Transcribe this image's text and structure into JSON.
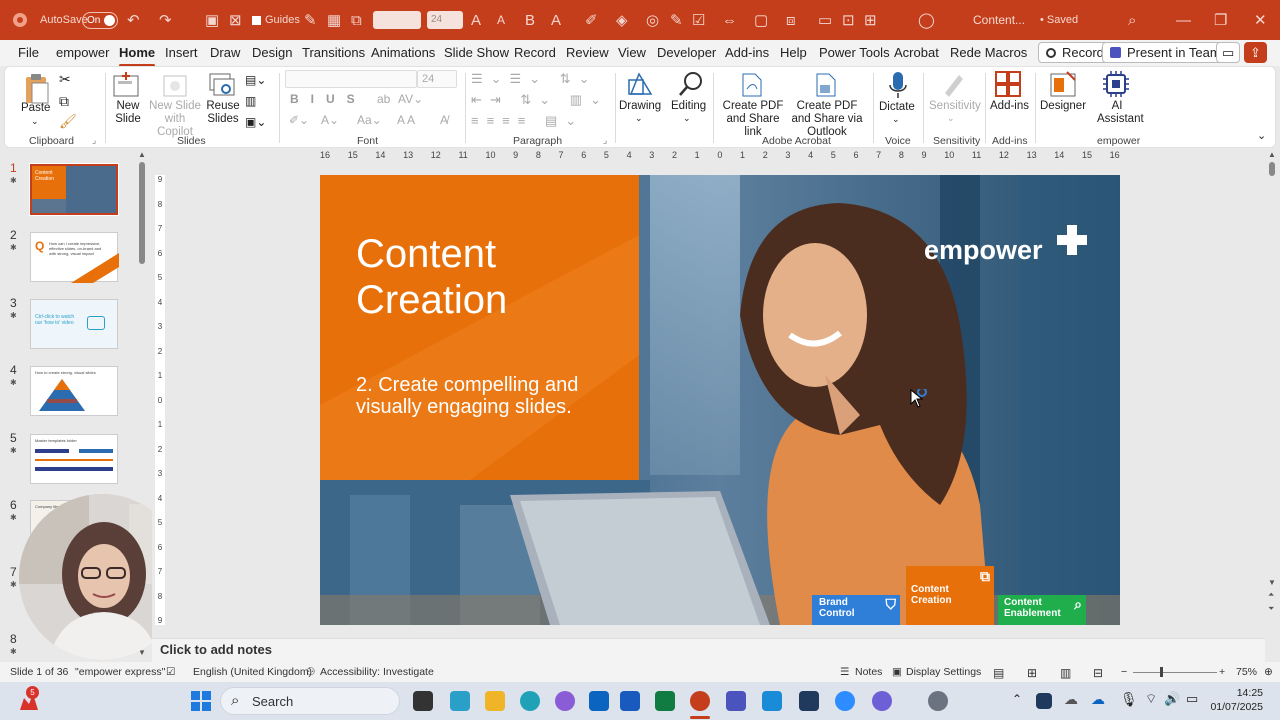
{
  "titlebar": {
    "autosave_label": "AutoSave",
    "autosave_state": "On",
    "guides_label": "Guides",
    "font_size": "24",
    "doc_title": "Content...",
    "saved_status": "• Saved"
  },
  "menu": {
    "items": [
      "File",
      "empower",
      "Home",
      "Insert",
      "Draw",
      "Design",
      "Transitions",
      "Animations",
      "Slide Show",
      "Record",
      "Review",
      "View",
      "Developer",
      "Add-ins",
      "Help",
      "Power Tools",
      "Acrobat",
      "Rede Macros"
    ],
    "record_button": "Record",
    "present_teams_button": "Present in Teams"
  },
  "ribbon": {
    "paste": "Paste",
    "clipboard_group": "Clipboard",
    "new_slide": "New Slide",
    "new_slide_copilot": "New Slide with Copilot",
    "reuse_slides": "Reuse Slides",
    "slides_group": "Slides",
    "font_size_box": "24",
    "font_group": "Font",
    "paragraph_group": "Paragraph",
    "drawing": "Drawing",
    "editing": "Editing",
    "create_pdf_share": "Create PDF and Share link",
    "create_pdf_outlook": "Create PDF and Share via Outlook",
    "acrobat_group": "Adobe Acrobat",
    "dictate": "Dictate",
    "voice_group": "Voice",
    "sensitivity": "Sensitivity",
    "sensitivity_group": "Sensitivity",
    "addins": "Add-ins",
    "addins_group": "Add-ins",
    "designer": "Designer",
    "ai_assistant": "AI Assistant",
    "empower_group": "empower"
  },
  "ruler": {
    "h_labels": [
      "16",
      "15",
      "14",
      "13",
      "12",
      "11",
      "10",
      "9",
      "8",
      "7",
      "6",
      "5",
      "4",
      "3",
      "2",
      "1",
      "0",
      "1",
      "2",
      "3",
      "4",
      "5",
      "6",
      "7",
      "8",
      "9",
      "10",
      "11",
      "12",
      "13",
      "14",
      "15",
      "16"
    ],
    "v_labels": [
      "9",
      "8",
      "7",
      "6",
      "5",
      "4",
      "3",
      "2",
      "1",
      "0",
      "1",
      "2",
      "3",
      "4",
      "5",
      "6",
      "7",
      "8",
      "9"
    ]
  },
  "thumbnails": [
    {
      "num": "1",
      "caption": "Content Creation"
    },
    {
      "num": "2",
      "caption": "How can I create impressive, effective slides, on-brand and with strong, visual impact"
    },
    {
      "num": "3",
      "caption": "Ctrl-click to watch our 'how to' video"
    },
    {
      "num": "4",
      "caption": "How to create strong, visual slides"
    },
    {
      "num": "5",
      "caption": "Master templates folder"
    },
    {
      "num": "6",
      "caption": "Company library"
    },
    {
      "num": "7",
      "caption": ""
    },
    {
      "num": "8",
      "caption": ""
    }
  ],
  "slide": {
    "title_line1": "Content",
    "title_line2": "Creation",
    "subtitle_line1": "2. Create compelling and",
    "subtitle_line2": "visually engaging slides.",
    "logo_text": "empower",
    "badges": [
      {
        "line1": "Brand",
        "line2": "Control",
        "color": "#2f7fd9"
      },
      {
        "line1": "Content",
        "line2": "Creation",
        "color": "#e8700a"
      },
      {
        "line1": "Content",
        "line2": "Enablement",
        "color": "#1fae4b"
      }
    ]
  },
  "notes_placeholder": "Click to add notes",
  "status": {
    "slide_counter": "Slide 1 of 36",
    "template": "\"empower express\"",
    "language": "English (United Kingdom)",
    "accessibility": "Accessibility: Investigate",
    "notes": "Notes",
    "display_settings": "Display Settings",
    "zoom": "75%"
  },
  "taskbar": {
    "search": "Search",
    "time": "14:25",
    "date": "01/07/2025",
    "badge_count": "5"
  },
  "colors": {
    "accent": "#c43e1c",
    "slide_orange": "#e8700a"
  }
}
